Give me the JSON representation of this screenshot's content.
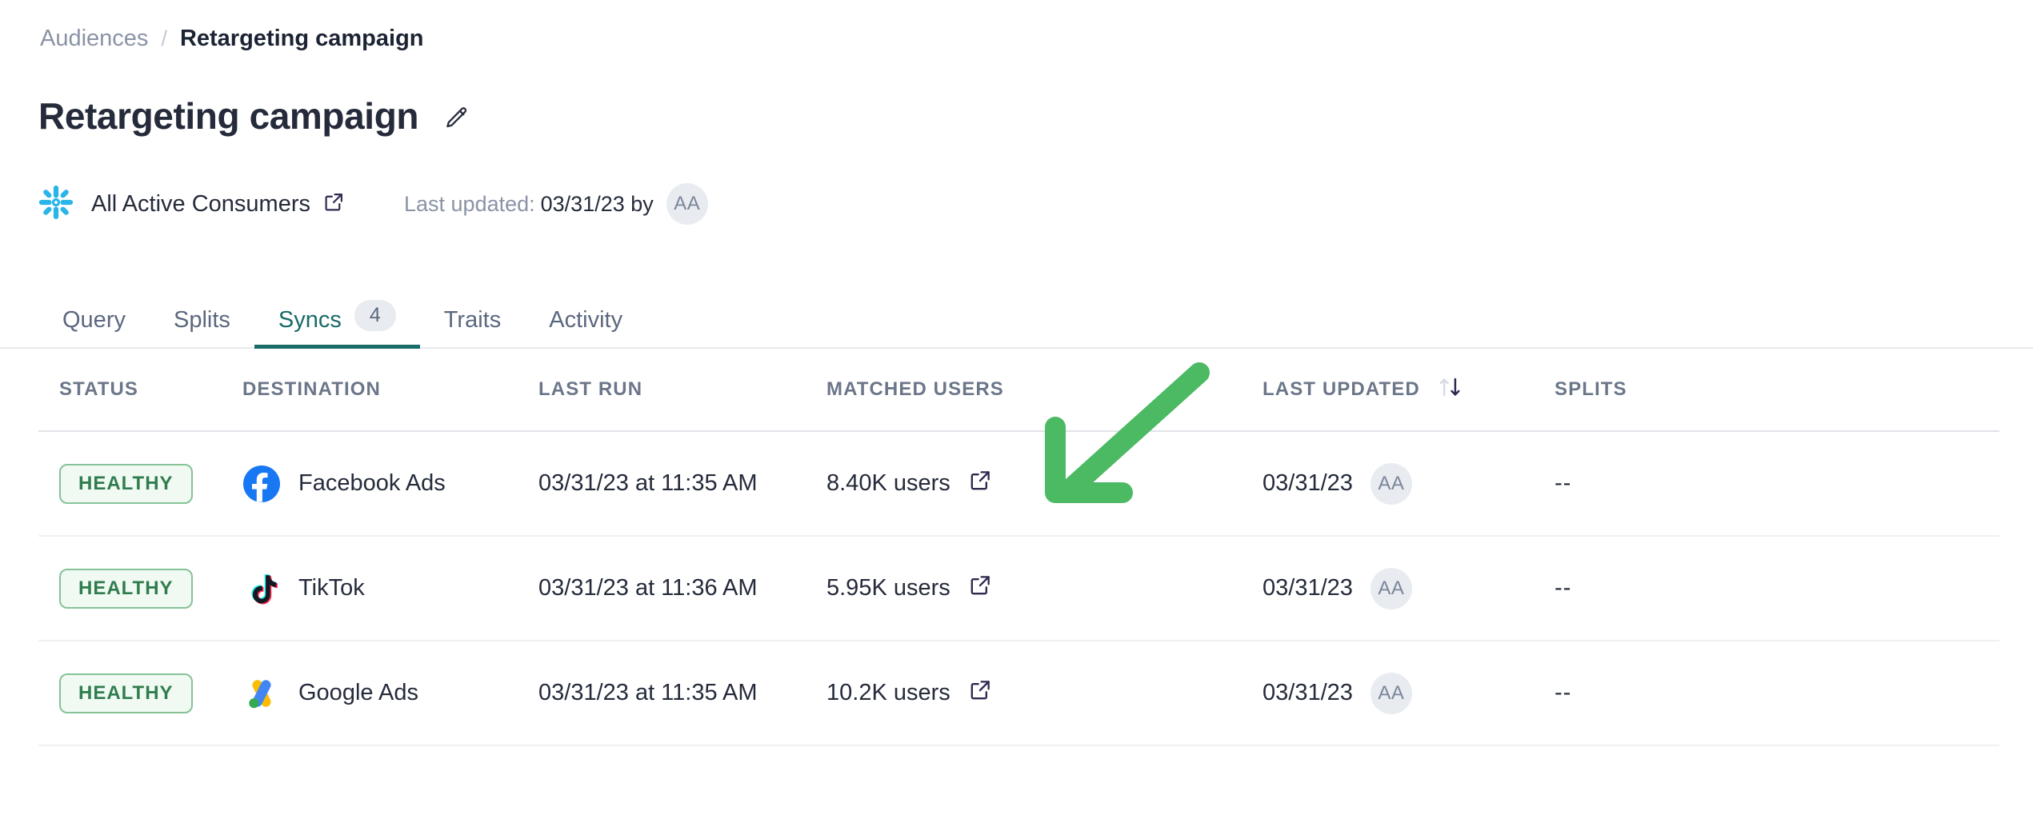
{
  "breadcrumb": {
    "parent": "Audiences",
    "separator": "/",
    "current": "Retargeting campaign"
  },
  "header": {
    "title": "Retargeting campaign",
    "edit_icon": "pencil-icon"
  },
  "meta": {
    "source_icon": "snowflake-icon",
    "source_name": "All Active Consumers",
    "source_link_icon": "external-link-icon",
    "last_updated_label": "Last updated:",
    "last_updated_value": "03/31/23 by",
    "updated_by_initials": "AA"
  },
  "tabs": [
    {
      "label": "Query",
      "badge": null,
      "active": false
    },
    {
      "label": "Splits",
      "badge": null,
      "active": false
    },
    {
      "label": "Syncs",
      "badge": "4",
      "active": true
    },
    {
      "label": "Traits",
      "badge": null,
      "active": false
    },
    {
      "label": "Activity",
      "badge": null,
      "active": false
    }
  ],
  "table": {
    "columns": [
      {
        "key": "status",
        "label": "STATUS",
        "sortable": false
      },
      {
        "key": "destination",
        "label": "DESTINATION",
        "sortable": false
      },
      {
        "key": "lastrun",
        "label": "LAST RUN",
        "sortable": false
      },
      {
        "key": "matched",
        "label": "MATCHED USERS",
        "sortable": false
      },
      {
        "key": "lastupdated",
        "label": "LAST UPDATED",
        "sortable": true,
        "sort_icon": "sort-arrows-icon",
        "sort_direction": "descending"
      },
      {
        "key": "splits",
        "label": "SPLITS",
        "sortable": false
      }
    ],
    "rows": [
      {
        "status": "HEALTHY",
        "destination": "Facebook Ads",
        "destination_logo": "facebook-logo-icon",
        "last_run": "03/31/23 at 11:35 AM",
        "matched_users": "8.40K users",
        "matched_link_icon": "external-link-icon",
        "last_updated": "03/31/23",
        "updated_by_initials": "AA",
        "splits": "--"
      },
      {
        "status": "HEALTHY",
        "destination": "TikTok",
        "destination_logo": "tiktok-logo-icon",
        "last_run": "03/31/23 at 11:36 AM",
        "matched_users": "5.95K users",
        "matched_link_icon": "external-link-icon",
        "last_updated": "03/31/23",
        "updated_by_initials": "AA",
        "splits": "--"
      },
      {
        "status": "HEALTHY",
        "destination": "Google Ads",
        "destination_logo": "google-ads-logo-icon",
        "last_run": "03/31/23 at 11:35 AM",
        "matched_users": "10.2K users",
        "matched_link_icon": "external-link-icon",
        "last_updated": "03/31/23",
        "updated_by_initials": "AA",
        "splits": "--"
      }
    ]
  },
  "annotation": {
    "type": "arrow",
    "color": "#4cb963",
    "points_to": "matched-users-external-link"
  },
  "colors": {
    "accent_teal": "#1a6b68",
    "status_green_text": "#2f7d4d",
    "status_green_border": "#85c397",
    "status_green_bg": "#f1f9f3",
    "snowflake_blue": "#29b5e8",
    "facebook_blue": "#1877f2",
    "annotation_green": "#4cb963",
    "text_primary": "#252b3b",
    "text_muted": "#8a93a5"
  }
}
